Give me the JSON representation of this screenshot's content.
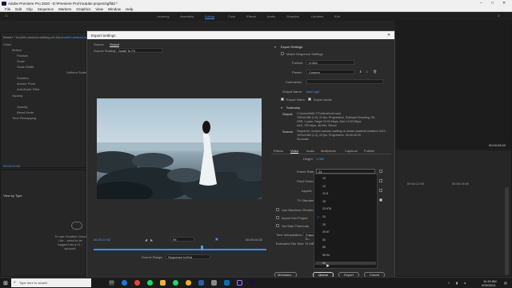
{
  "app": {
    "title": "Adobe Premiere Pro 2020 - E:\\Premiere Pro\\Youtube projects\\gffdd *",
    "menu": [
      "File",
      "Edit",
      "Clip",
      "Sequence",
      "Markers",
      "Graphics",
      "View",
      "Window",
      "Help"
    ],
    "workspaces": [
      "Learning",
      "Assembly",
      "Editing",
      "Color",
      "Effects",
      "Audio",
      "Graphics",
      "Libraries",
      "Edit"
    ],
    "active_workspace": "Editing"
  },
  "left_panel": {
    "clip_name": "Master * modern-woman-walking-on-bla...",
    "seq_tab": "modern-woman-walkin...",
    "video_header": "Video",
    "props": [
      "Motion",
      "Position",
      "Scale",
      "Scale Width",
      "Rotation",
      "Anchor Point",
      "Anti-flicker Filter",
      "Opacity",
      "Opacity",
      "Blend Mode",
      "Time Remapping"
    ],
    "uniform_scale": "Uniform Scale",
    "timecode": "00:03:22:04",
    "project_label": "View by Type",
    "cc_notice": "To use Creative Cloud Libr... need to be logged into a Cr... account."
  },
  "dialog": {
    "title": "Export Settings",
    "tabs": [
      "Source",
      "Output"
    ],
    "active_tab": "Output",
    "source_scaling_label": "Source Scaling:",
    "source_scaling_value": "Scale To Fit",
    "export_settings_header": "Export Settings",
    "match_sequence": "Match Sequence Settings",
    "format_label": "Format:",
    "format_value": "H.264",
    "preset_label": "Preset:",
    "preset_value": "Custom",
    "comments_label": "Comments:",
    "output_name_label": "Output Name:",
    "output_name_value": "lumi.mp4",
    "export_video": "Export Video",
    "export_audio": "Export Audio",
    "summary_header": "Summary",
    "summary_output_label": "Output:",
    "summary_output_lines": [
      "C:\\Users\\MAIL77\\Videos\\lumi.mp4",
      "1920x1080 (1.0), 24 fps, Progressive, Software Encoding, 00...",
      "VBR, 1 pass, Target 10.00 Mbps, Max 12.00 Mbps",
      "AAC, 320 kbps, 48 kHz, Stereo"
    ],
    "summary_source_label": "Source:",
    "summary_source_lines": [
      "Sequence, modern-woman-walking-on-beach-towards-boulders-1512...",
      "1920x1080 (1.0), 24 fps, Progressive, 00:00:30:20",
      "No Audio"
    ],
    "settings_tabs": [
      "Effects",
      "Video",
      "Audio",
      "Multiplexer",
      "Captions",
      "Publish"
    ],
    "active_settings_tab": "Video",
    "height_label": "Height:",
    "height_value": "1,080",
    "frame_rate_label": "Frame Rate:",
    "frame_rate_value": "24",
    "field_order_label": "Field Order:",
    "aspect_label": "Aspect:",
    "tv_standard_label": "TV Standard:",
    "use_max_render": "Use Maximum Render Qua...",
    "import_into_project": "Import into Project",
    "set_start_timecode": "Set Start Timecode",
    "time_interp_label": "Time Interpolation:",
    "time_interp_value": "Frame S...",
    "file_size_label": "Estimated File Size:",
    "file_size_value": "74 MB",
    "source_range_label": "Source Range:",
    "source_range_value": "Sequence In/Out",
    "preview_timecode_in": "00:00:24:02",
    "preview_timecode_out": "00:00:28:20",
    "fit_value": "Fit",
    "buttons": {
      "metadata": "Metadata...",
      "queue": "Queue",
      "export": "Export",
      "cancel": "Cancel"
    }
  },
  "frame_rate_options": {
    "items": [
      "10",
      "12",
      "12.5",
      "15",
      "23.976",
      "24",
      "25",
      "29.97",
      "30",
      "50",
      "59.94",
      "60"
    ],
    "selected": "24",
    "hovered": "60"
  },
  "right_panel": {
    "timecode": "00:00:28:20",
    "ruler": [
      "00:00:12:00",
      "00:00:16:00"
    ]
  },
  "taskbar": {
    "search_placeholder": "Type here to search",
    "time": "11:19 AM",
    "date": "9/25/2021"
  },
  "colors": {
    "accent": "#3d8ef0",
    "dialog_bg": "#2b2b2b",
    "app_bg": "#232323"
  }
}
